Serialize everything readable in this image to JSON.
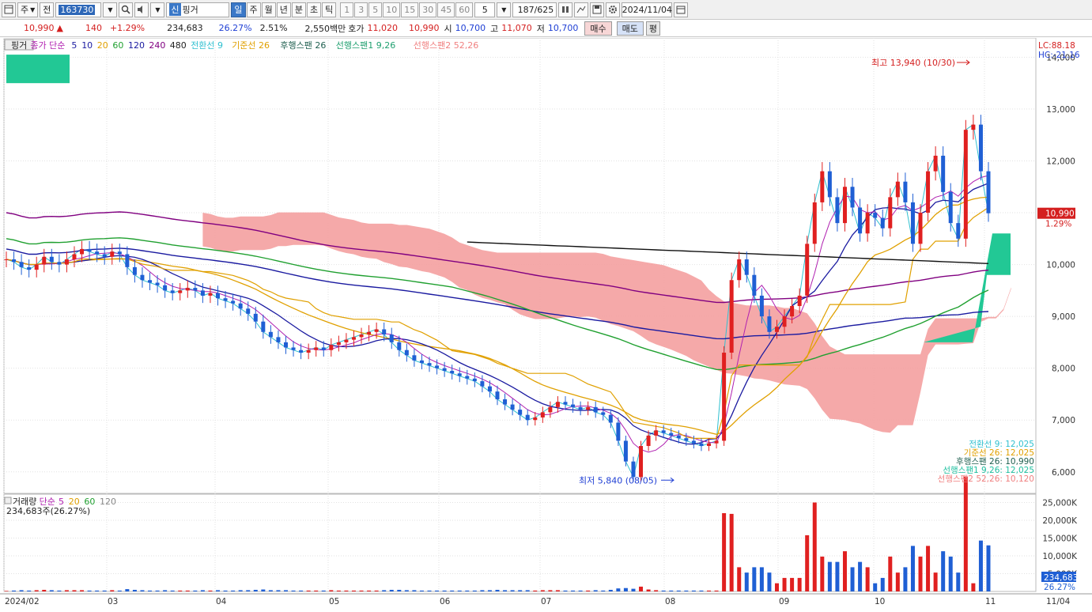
{
  "toolbar": {
    "market": "주",
    "prev": "전",
    "code": "163730",
    "name": "핑거",
    "name_badge": "신",
    "periods": [
      "일",
      "주",
      "월",
      "년",
      "분",
      "초",
      "틱"
    ],
    "active_period": "일",
    "intervals": [
      "1",
      "3",
      "5",
      "10",
      "15",
      "30",
      "45",
      "60"
    ],
    "interval_value": "5",
    "count": "187",
    "count_total": "/625",
    "date": "2024/11/04",
    "icons": [
      "stepper-icon",
      "cursor-icon",
      "save-icon",
      "settings-icon"
    ]
  },
  "quote": {
    "price": "10,990",
    "arrow": "▲",
    "change": "140",
    "change_pct": "+1.29%",
    "volume": "234,683",
    "turnover_pct": "26.27%",
    "ratio": "2.51%",
    "amount": "2,550백만",
    "ask_label": "호가",
    "ask": "11,020",
    "bid": "10,990",
    "open_label": "시",
    "open": "10,700",
    "high_label": "고",
    "high": "11,070",
    "low_label": "저",
    "low": "10,700",
    "buy_label": "매수",
    "sell_label": "매도",
    "eval_label": "평"
  },
  "price_panel": {
    "legend": [
      {
        "text": "핑거",
        "color": "#222222"
      },
      {
        "text": "종가 단순",
        "color": "#b020b0"
      },
      {
        "text": "5",
        "color": "#1a1aa0"
      },
      {
        "text": "10",
        "color": "#1a1aa0"
      },
      {
        "text": "20",
        "color": "#e0a000"
      },
      {
        "text": "60",
        "color": "#20a030"
      },
      {
        "text": "120",
        "color": "#1a1aa0"
      },
      {
        "text": "240",
        "color": "#800080"
      },
      {
        "text": "480",
        "color": "#222222"
      },
      {
        "text": "전환선 9",
        "color": "#30c0d0"
      },
      {
        "text": "기준선 26",
        "color": "#e0a000"
      },
      {
        "text": "후행스팬 26",
        "color": "#206050"
      },
      {
        "text": "선행스팬1 9,26",
        "color": "#20a070"
      },
      {
        "text": "선행스팬2 52,26",
        "color": "#f08080"
      }
    ],
    "lc": "LC:88.18",
    "hc": "HC:-21.16",
    "y_ticks": [
      "14,000",
      "13,000",
      "12,000",
      "11,000",
      "10,000",
      "9,000",
      "8,000",
      "7,000",
      "6,000"
    ],
    "price_tag": "10,990",
    "price_tag_pct": "1.29%",
    "high_note": "최고 13,940 (10/30)",
    "low_note": "최저 5,840 (08/05)",
    "ichimoku_values": [
      {
        "text": "전환선 9: 12,025",
        "color": "#30c0d0"
      },
      {
        "text": "기준선 26: 12,025",
        "color": "#e0a000"
      },
      {
        "text": "후행스팬 26: 10,990",
        "color": "#206050"
      },
      {
        "text": "선행스팬1 9,26: 12,025",
        "color": "#20c0a0"
      },
      {
        "text": "선행스팬2 52,26: 10,120",
        "color": "#f08080"
      }
    ]
  },
  "volume_panel": {
    "legend": [
      {
        "text": "거래량",
        "color": "#222222"
      },
      {
        "text": "단순",
        "color": "#b020b0"
      },
      {
        "text": "5",
        "color": "#b020b0"
      },
      {
        "text": "20",
        "color": "#e0a000"
      },
      {
        "text": "60",
        "color": "#20a030"
      },
      {
        "text": "120",
        "color": "#888888"
      }
    ],
    "info": "234,683주(26.27%)",
    "y_ticks": [
      "25,000K",
      "20,000K",
      "15,000K",
      "10,000K",
      "5,000K"
    ],
    "tag": "234,683",
    "tag_pct": "26.27%"
  },
  "x_ticks": [
    "2024/02",
    "03",
    "04",
    "05",
    "06",
    "07",
    "08",
    "09",
    "10",
    "11",
    "11/04"
  ],
  "chart_data": {
    "type": "candlestick",
    "y_range": [
      5600,
      14250
    ],
    "closes": [
      10100,
      10050,
      9950,
      9900,
      10000,
      10150,
      10050,
      10000,
      10100,
      10200,
      10300,
      10250,
      10200,
      10150,
      10250,
      10200,
      9950,
      9800,
      9700,
      9650,
      9600,
      9500,
      9450,
      9500,
      9550,
      9500,
      9400,
      9450,
      9350,
      9300,
      9250,
      9150,
      9050,
      8900,
      8700,
      8600,
      8500,
      8400,
      8350,
      8300,
      8350,
      8400,
      8350,
      8450,
      8500,
      8550,
      8600,
      8650,
      8700,
      8750,
      8650,
      8500,
      8350,
      8250,
      8150,
      8100,
      8050,
      8000,
      7950,
      7900,
      7850,
      7800,
      7750,
      7650,
      7550,
      7400,
      7300,
      7200,
      7100,
      7000,
      7050,
      7150,
      7250,
      7350,
      7300,
      7250,
      7200,
      7250,
      7150,
      7100,
      6950,
      6600,
      6200,
      5900,
      6500,
      6700,
      6800,
      6750,
      6700,
      6650,
      6600,
      6550,
      6500,
      6550,
      6600,
      8300,
      9700,
      10100,
      9800,
      9400,
      9000,
      8700,
      8800,
      9000,
      9200,
      9400,
      10400,
      11200,
      11800,
      11300,
      10800,
      11500,
      11100,
      10600,
      11000,
      10900,
      10700,
      11300,
      11600,
      11200,
      10400,
      11000,
      11800,
      12100,
      11400,
      10800,
      10500,
      12600,
      12700,
      11800,
      10990
    ],
    "x_ticks": [
      "2024/02",
      "03",
      "04",
      "05",
      "06",
      "07",
      "08",
      "09",
      "10",
      "11"
    ]
  }
}
